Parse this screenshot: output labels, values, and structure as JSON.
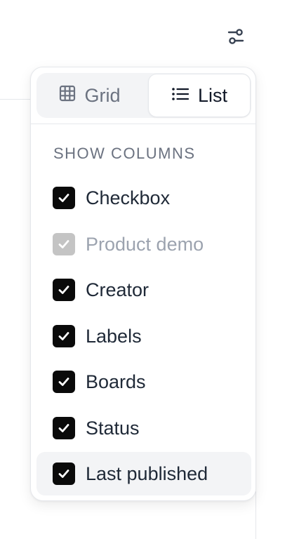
{
  "toolbar": {
    "filter_icon": "sliders-icon"
  },
  "view_toggle": {
    "grid_label": "Grid",
    "grid_icon": "grid-icon",
    "list_label": "List",
    "list_icon": "list-icon",
    "selected": "List"
  },
  "columns_section": {
    "title": "SHOW COLUMNS",
    "items": [
      {
        "label": "Checkbox",
        "checked": true,
        "disabled": false
      },
      {
        "label": "Product demo",
        "checked": true,
        "disabled": true
      },
      {
        "label": "Creator",
        "checked": true,
        "disabled": false
      },
      {
        "label": "Labels",
        "checked": true,
        "disabled": false
      },
      {
        "label": "Boards",
        "checked": true,
        "disabled": false
      },
      {
        "label": "Status",
        "checked": true,
        "disabled": false
      },
      {
        "label": "Last published",
        "checked": true,
        "disabled": false,
        "hovered": true
      }
    ]
  },
  "colors": {
    "checkbox_checked": "#0a0a0a",
    "checkbox_disabled": "#c4c4c4",
    "hover_bg": "#f3f4f6"
  }
}
